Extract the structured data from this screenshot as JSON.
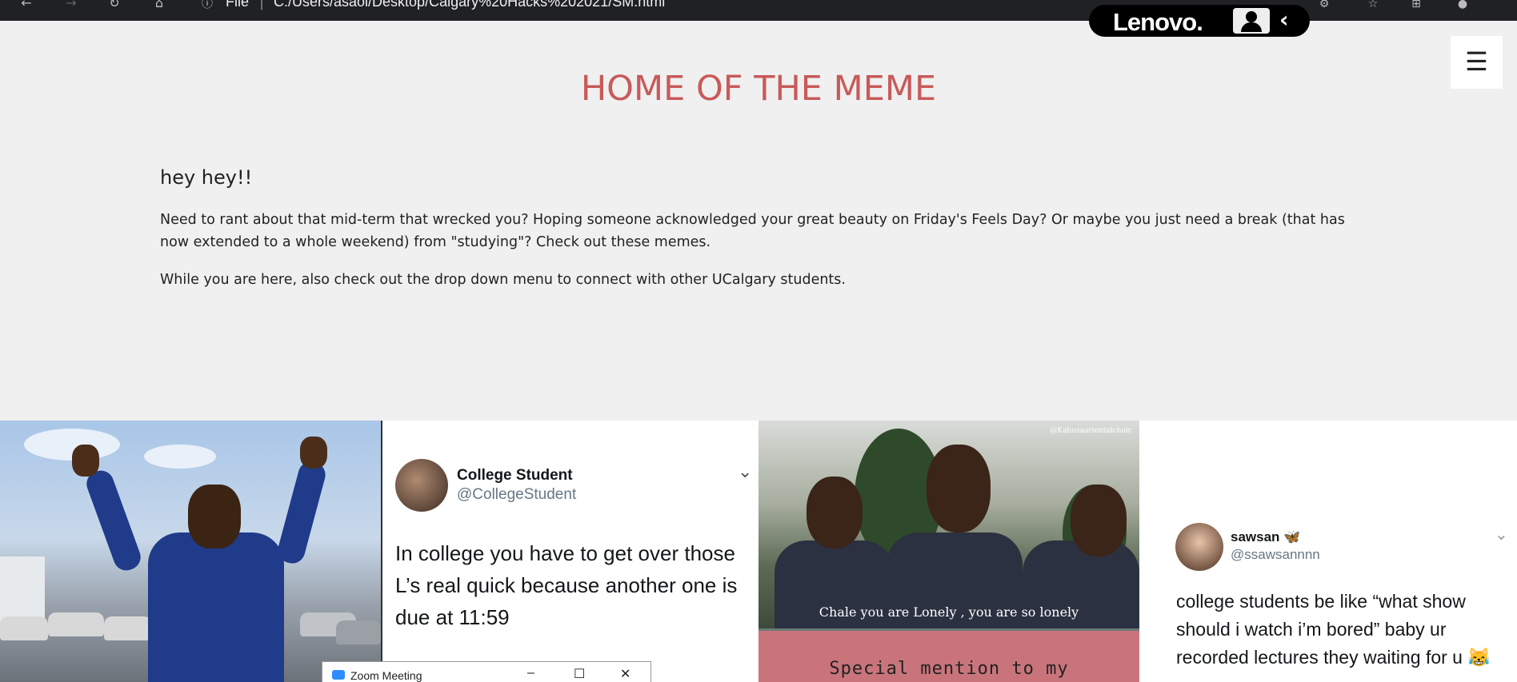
{
  "browser": {
    "back_icon": "arrow-left-icon",
    "info_icon": "ⓘ",
    "file_label": "File",
    "separator": "|",
    "url": "C:/Users/asaol/Desktop/Calgary%20Hacks%202021/SM.html"
  },
  "overlay": {
    "brand": "Lenovo.",
    "back_glyph": "‹"
  },
  "menu": {
    "hamburger": "☰"
  },
  "page": {
    "title": "HOME OF THE MEME",
    "greeting": "hey hey!!",
    "paragraph1": "Need to rant about that mid-term that wrecked you? Hoping someone acknowledged your great beauty on Friday's Feels Day? Or maybe you just need a break (that has now extended to a whole weekend) from \"studying\"? Check out these memes.",
    "paragraph2": "While you are here, also check out the drop down menu to connect with other UCalgary students."
  },
  "memes": {
    "tweet1": {
      "name": "College Student",
      "handle": "@CollegeStudent",
      "text": "In college you have to get over those L’s real quick because another one is due at 11:59",
      "chevron": "⌄"
    },
    "meme3": {
      "tag": "@Kabusaorientalchoir",
      "caption": "Chale you are Lonely , you are so lonely",
      "pink_text": "Special mention to my"
    },
    "tweet2": {
      "name": "sawsan 🦋",
      "handle": "@ssawsannnn",
      "text": "college students be like “what show should i watch i’m bored” baby ur recorded lectures they waiting for u 😹",
      "chevron": "⌄"
    }
  },
  "zoom": {
    "title": "Zoom Meeting",
    "minimize": "–",
    "maximize": "☐",
    "close": "✕"
  }
}
